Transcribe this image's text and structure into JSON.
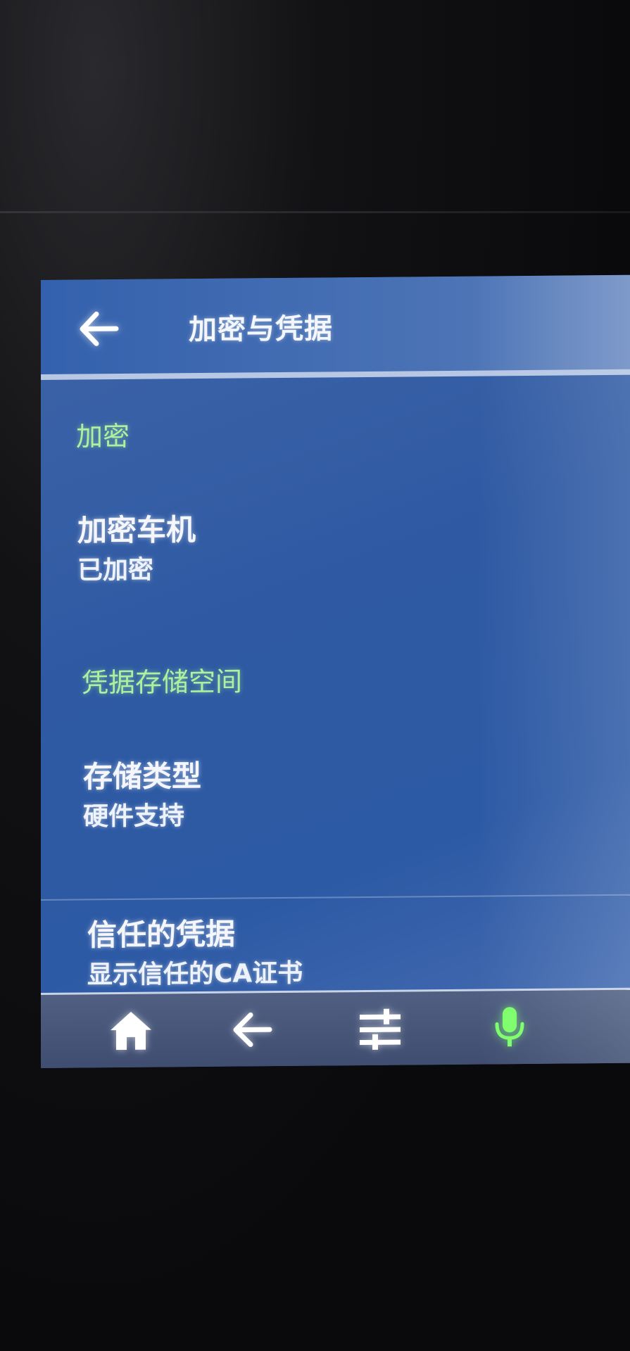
{
  "header": {
    "back_icon": "arrow-left-icon",
    "title": "加密与凭据"
  },
  "sections": {
    "encryption": {
      "header": "加密",
      "items": [
        {
          "title": "加密车机",
          "summary": "已加密"
        }
      ]
    },
    "credential_storage": {
      "header": "凭据存储空间",
      "items": [
        {
          "title": "存储类型",
          "summary": "硬件支持"
        },
        {
          "title": "信任的凭据",
          "summary": "显示信任的CA证书"
        }
      ]
    }
  },
  "nav_bar": {
    "buttons": [
      "home-icon",
      "back-arrow-icon",
      "sliders-icon",
      "microphone-icon"
    ]
  },
  "colors": {
    "accent_green": "#aef0a0",
    "screen_blue": "#2f5aa3",
    "text_white": "#f4f6fb",
    "mic_green": "#7dff6a"
  }
}
